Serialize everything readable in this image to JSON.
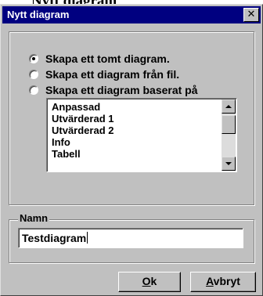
{
  "background_heading": "Nytt diagram",
  "dialog": {
    "title": "Nytt diagram",
    "close_glyph": "✕"
  },
  "options": [
    {
      "label": "Skapa ett tomt diagram.",
      "checked": true
    },
    {
      "label": "Skapa ett diagram från fil.",
      "checked": false
    },
    {
      "label": "Skapa ett diagram baserat på",
      "checked": false
    }
  ],
  "template_list": {
    "items": [
      "Anpassad",
      "Utvärderad 1",
      "Utvärderad 2",
      "Info",
      "Tabell"
    ]
  },
  "name_group": {
    "label": "Namn",
    "value": "Testdiagram"
  },
  "buttons": {
    "ok": {
      "mnemonic": "O",
      "rest": "k"
    },
    "cancel": {
      "mnemonic": "A",
      "rest": "vbryt"
    }
  },
  "colors": {
    "titlebar": "#000080",
    "face": "#c0c0c0"
  }
}
